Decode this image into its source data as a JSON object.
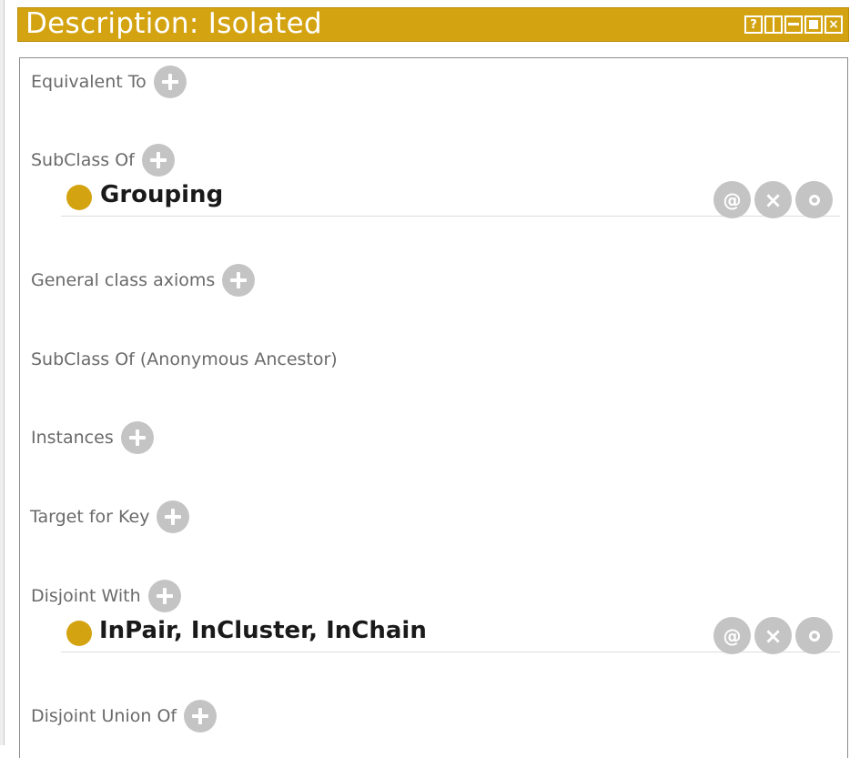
{
  "window": {
    "title": "Description: Isolated",
    "help_glyph": "?",
    "close_glyph": "×"
  },
  "sections": {
    "equivalent_to": "Equivalent To",
    "subclass_of": "SubClass Of",
    "general_axioms": "General class axioms",
    "anonymous_ancestor": "SubClass Of (Anonymous Ancestor)",
    "instances": "Instances",
    "target_for_key": "Target for Key",
    "disjoint_with": "Disjoint With",
    "disjoint_union_of": "Disjoint Union Of"
  },
  "subclass_items": [
    {
      "label": "Grouping",
      "annotate_glyph": "@",
      "delete_glyph": "×"
    }
  ],
  "disjoint_items": [
    {
      "label": "InPair, InCluster, InChain",
      "annotate_glyph": "@",
      "delete_glyph": "×"
    }
  ],
  "colors": {
    "accent": "#d4a311",
    "button_gray": "#c4c4c4",
    "label_gray": "#6a6a6a"
  }
}
